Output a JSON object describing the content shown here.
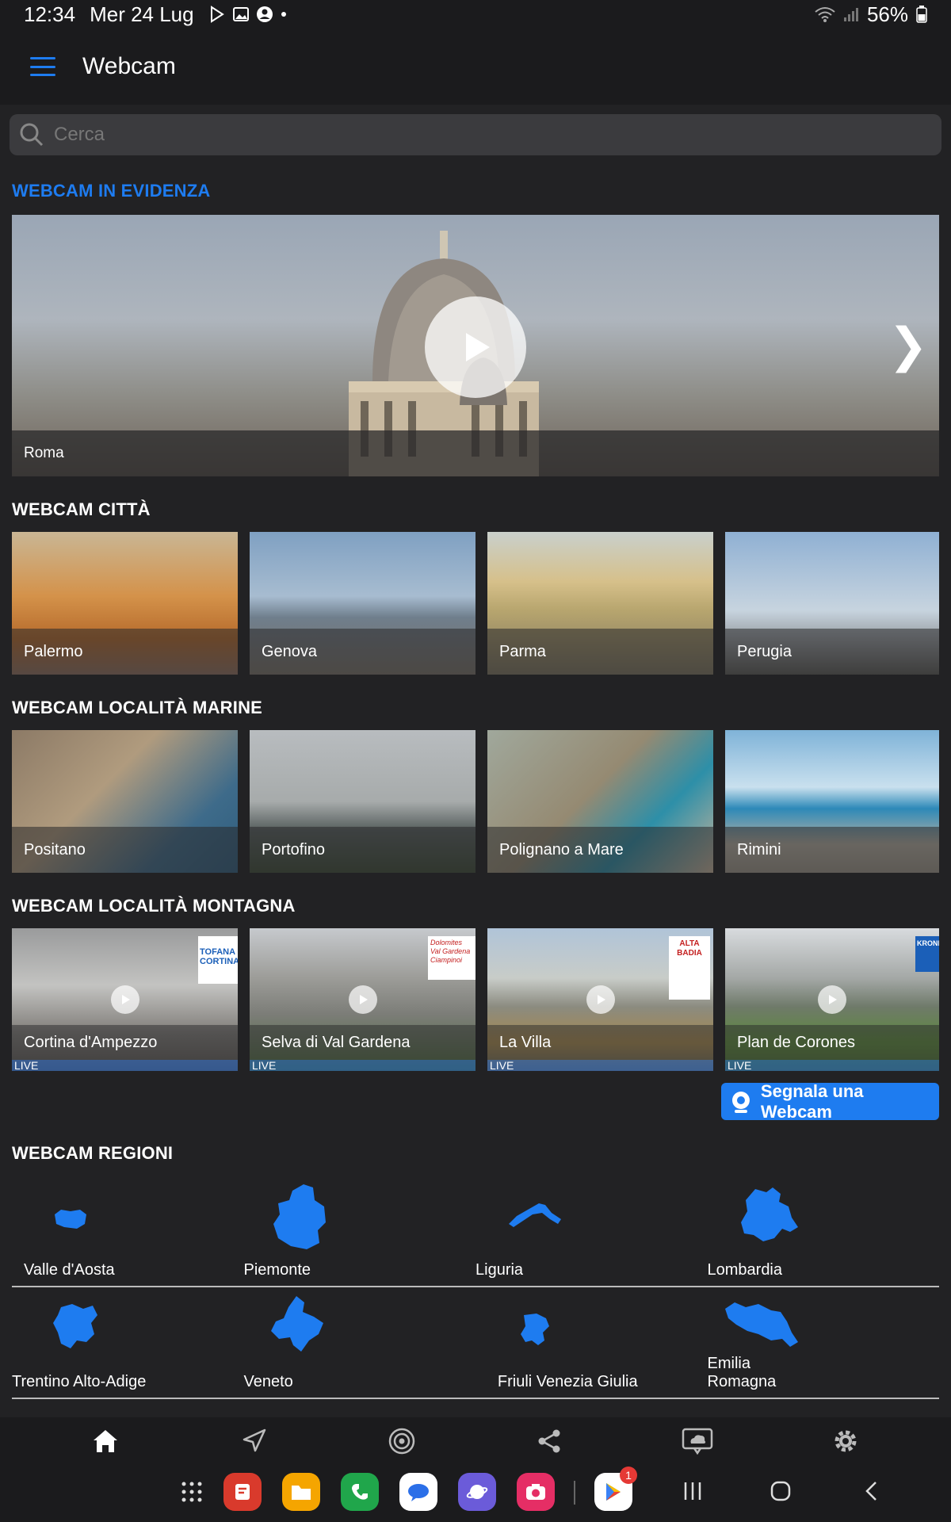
{
  "status": {
    "time": "12:34",
    "date": "Mer 24 Lug",
    "battery": "56%"
  },
  "appbar": {
    "title": "Webcam"
  },
  "search": {
    "placeholder": "Cerca"
  },
  "featured": {
    "title": "WEBCAM IN EVIDENZA",
    "caption": "Roma",
    "next_glyph": "❯"
  },
  "cities": {
    "title": "WEBCAM CITTÀ",
    "items": [
      "Palermo",
      "Genova",
      "Parma",
      "Perugia"
    ]
  },
  "sea": {
    "title": "WEBCAM LOCALITÀ MARINE",
    "items": [
      "Positano",
      "Portofino",
      "Polignano a Mare",
      "Rimini"
    ]
  },
  "mountain": {
    "title": "WEBCAM LOCALITÀ MONTAGNA",
    "items": [
      "Cortina d'Ampezzo",
      "Selva di Val Gardena",
      "La Villa",
      "Plan de Corones"
    ],
    "live_label": "LIVE",
    "overlay_logos": [
      "TOFANA CORTINA",
      "Dolomites Val Gardena Ciampinoi",
      "ALTA BADIA",
      "KRONP"
    ]
  },
  "report_button": "Segnala una Webcam",
  "regions": {
    "title": "WEBCAM REGIONI",
    "row1": [
      "Valle d'Aosta",
      "Piemonte",
      "Liguria",
      "Lombardia"
    ],
    "row2": [
      "Trentino Alto-Adige",
      "Veneto",
      "Friuli Venezia Giulia",
      "Emilia Romagna"
    ]
  },
  "dock": {
    "badge": "1"
  },
  "colors": {
    "accent": "#1e7cf0",
    "background": "#222224",
    "bar": "#1b1b1d"
  }
}
